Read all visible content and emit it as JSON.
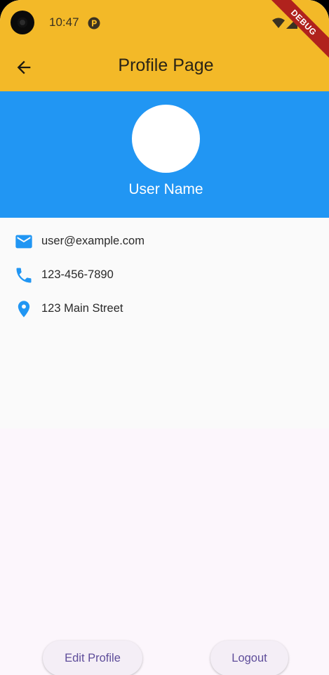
{
  "status_bar": {
    "time": "10:47",
    "debug_label": "DEBUG"
  },
  "app_bar": {
    "title": "Profile Page",
    "back_icon": "arrow-back-icon",
    "background": "#f3b928"
  },
  "profile_header": {
    "user_name": "User Name",
    "background": "#2196f3"
  },
  "contact_info": [
    {
      "icon": "email-icon",
      "text": "user@example.com"
    },
    {
      "icon": "phone-icon",
      "text": "123-456-7890"
    },
    {
      "icon": "location-icon",
      "text": "123 Main Street"
    }
  ],
  "actions": {
    "edit_label": "Edit Profile",
    "logout_label": "Logout"
  },
  "colors": {
    "accent": "#2196f3",
    "button_text": "#5e4d9a"
  }
}
